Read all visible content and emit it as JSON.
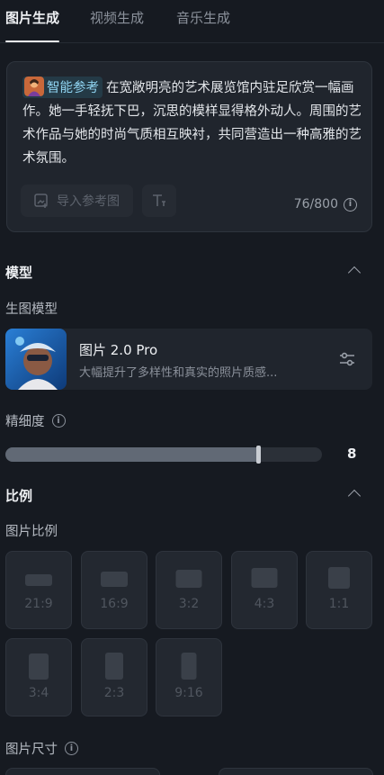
{
  "tabs": [
    {
      "label": "图片生成",
      "active": true
    },
    {
      "label": "视频生成",
      "active": false
    },
    {
      "label": "音乐生成",
      "active": false
    }
  ],
  "prompt": {
    "reference_chip": "智能参考",
    "text": "在宽敞明亮的艺术展览馆内驻足欣赏一幅画作。她一手轻抚下巴，沉思的模样显得格外动人。周围的艺术作品与她的时尚气质相互映衬，共同营造出一种高雅的艺术氛围。",
    "import_label": "导入参考图",
    "char_count": "76/800"
  },
  "model_section": {
    "title": "模型",
    "sub_label": "生图模型",
    "model_name": "图片 2.0 Pro",
    "model_desc": "大幅提升了多样性和真实的照片质感..."
  },
  "detail": {
    "label": "精细度",
    "value": "8",
    "fraction": 0.8
  },
  "ratio_section": {
    "title": "比例",
    "sub_label": "图片比例",
    "ratios": [
      "21:9",
      "16:9",
      "3:2",
      "4:3",
      "1:1",
      "3:4",
      "2:3",
      "9:16"
    ]
  },
  "size_section": {
    "label": "图片尺寸"
  },
  "colors": {
    "background": "#161a21",
    "card": "#20252d",
    "accent_chip": "#8fd3f0"
  }
}
